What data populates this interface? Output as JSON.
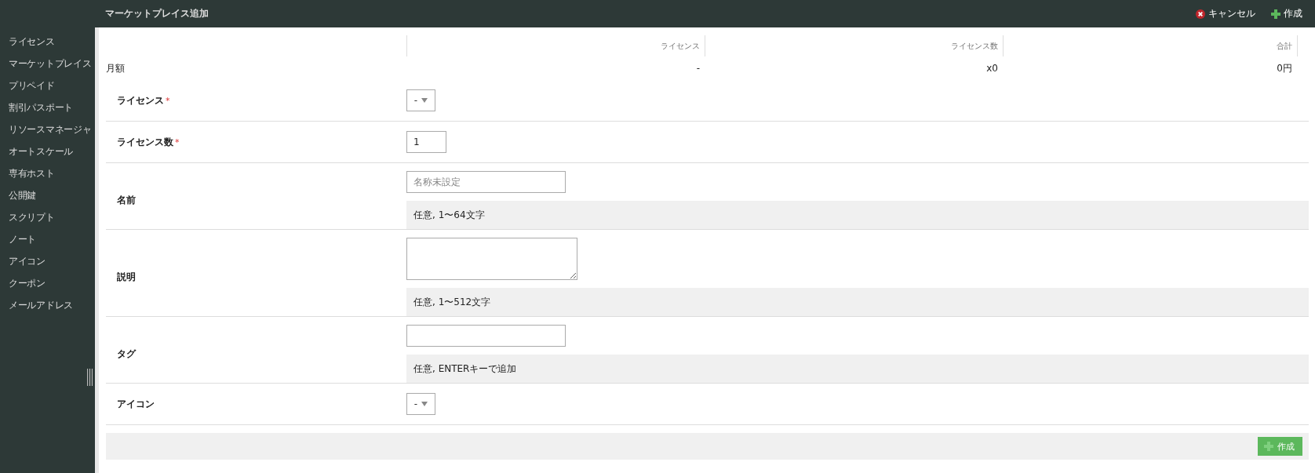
{
  "header": {
    "title": "マーケットプレイス追加",
    "actions": [
      {
        "kind": "cancel",
        "label": "キャンセル"
      },
      {
        "kind": "create",
        "label": "作成"
      }
    ]
  },
  "sidebar": {
    "items": [
      "ライセンス",
      "マーケットプレイス",
      "プリペイド",
      "割引パスポート",
      "リソースマネージャ",
      "オートスケール",
      "専有ホスト",
      "公開鍵",
      "スクリプト",
      "ノート",
      "アイコン",
      "クーポン",
      "メールアドレス"
    ]
  },
  "summary": {
    "columns": [
      "ライセンス",
      "ライセンス数",
      "合計"
    ],
    "row": {
      "label": "月額",
      "cells": [
        "-",
        "x0",
        "0円"
      ]
    }
  },
  "form": {
    "fields": [
      {
        "label": "ライセンス",
        "required_mark": "*",
        "kind": "select",
        "value": "-"
      },
      {
        "label": "ライセンス数",
        "required_mark": "*",
        "kind": "number",
        "value": "1"
      },
      {
        "label": "名前",
        "kind": "text",
        "placeholder": "名称未設定",
        "hint": "任意, 1〜64文字"
      },
      {
        "label": "説明",
        "kind": "textarea",
        "hint": "任意, 1〜512文字"
      },
      {
        "label": "タグ",
        "kind": "text",
        "hint": "任意, ENTERキーで追加"
      },
      {
        "label": "アイコン",
        "kind": "select",
        "value": "-"
      }
    ]
  },
  "footer": {
    "button": "作成"
  }
}
